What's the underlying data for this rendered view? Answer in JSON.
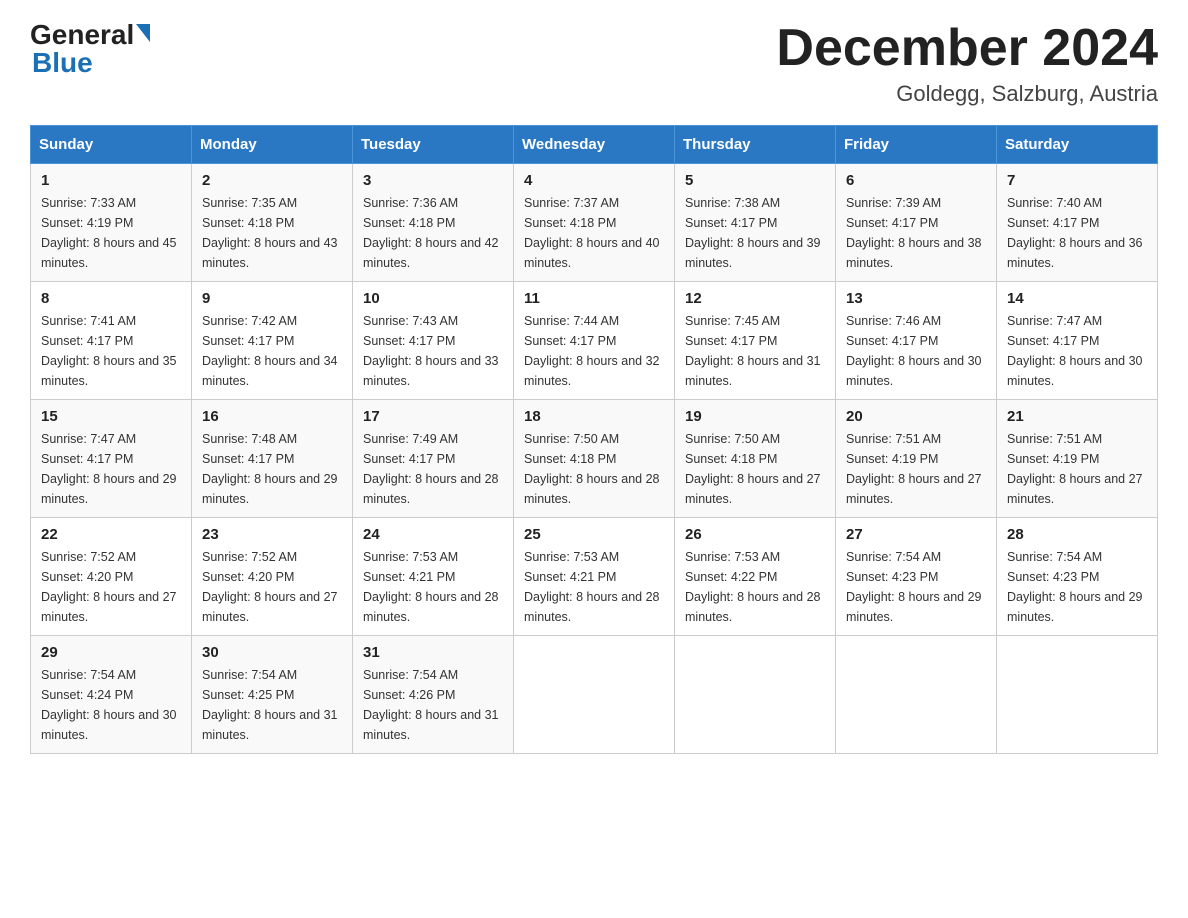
{
  "header": {
    "logo_general": "General",
    "logo_blue": "Blue",
    "month_title": "December 2024",
    "location": "Goldegg, Salzburg, Austria"
  },
  "days_of_week": [
    "Sunday",
    "Monday",
    "Tuesday",
    "Wednesday",
    "Thursday",
    "Friday",
    "Saturday"
  ],
  "weeks": [
    [
      {
        "day": "1",
        "sunrise": "7:33 AM",
        "sunset": "4:19 PM",
        "daylight": "8 hours and 45 minutes."
      },
      {
        "day": "2",
        "sunrise": "7:35 AM",
        "sunset": "4:18 PM",
        "daylight": "8 hours and 43 minutes."
      },
      {
        "day": "3",
        "sunrise": "7:36 AM",
        "sunset": "4:18 PM",
        "daylight": "8 hours and 42 minutes."
      },
      {
        "day": "4",
        "sunrise": "7:37 AM",
        "sunset": "4:18 PM",
        "daylight": "8 hours and 40 minutes."
      },
      {
        "day": "5",
        "sunrise": "7:38 AM",
        "sunset": "4:17 PM",
        "daylight": "8 hours and 39 minutes."
      },
      {
        "day": "6",
        "sunrise": "7:39 AM",
        "sunset": "4:17 PM",
        "daylight": "8 hours and 38 minutes."
      },
      {
        "day": "7",
        "sunrise": "7:40 AM",
        "sunset": "4:17 PM",
        "daylight": "8 hours and 36 minutes."
      }
    ],
    [
      {
        "day": "8",
        "sunrise": "7:41 AM",
        "sunset": "4:17 PM",
        "daylight": "8 hours and 35 minutes."
      },
      {
        "day": "9",
        "sunrise": "7:42 AM",
        "sunset": "4:17 PM",
        "daylight": "8 hours and 34 minutes."
      },
      {
        "day": "10",
        "sunrise": "7:43 AM",
        "sunset": "4:17 PM",
        "daylight": "8 hours and 33 minutes."
      },
      {
        "day": "11",
        "sunrise": "7:44 AM",
        "sunset": "4:17 PM",
        "daylight": "8 hours and 32 minutes."
      },
      {
        "day": "12",
        "sunrise": "7:45 AM",
        "sunset": "4:17 PM",
        "daylight": "8 hours and 31 minutes."
      },
      {
        "day": "13",
        "sunrise": "7:46 AM",
        "sunset": "4:17 PM",
        "daylight": "8 hours and 30 minutes."
      },
      {
        "day": "14",
        "sunrise": "7:47 AM",
        "sunset": "4:17 PM",
        "daylight": "8 hours and 30 minutes."
      }
    ],
    [
      {
        "day": "15",
        "sunrise": "7:47 AM",
        "sunset": "4:17 PM",
        "daylight": "8 hours and 29 minutes."
      },
      {
        "day": "16",
        "sunrise": "7:48 AM",
        "sunset": "4:17 PM",
        "daylight": "8 hours and 29 minutes."
      },
      {
        "day": "17",
        "sunrise": "7:49 AM",
        "sunset": "4:17 PM",
        "daylight": "8 hours and 28 minutes."
      },
      {
        "day": "18",
        "sunrise": "7:50 AM",
        "sunset": "4:18 PM",
        "daylight": "8 hours and 28 minutes."
      },
      {
        "day": "19",
        "sunrise": "7:50 AM",
        "sunset": "4:18 PM",
        "daylight": "8 hours and 27 minutes."
      },
      {
        "day": "20",
        "sunrise": "7:51 AM",
        "sunset": "4:19 PM",
        "daylight": "8 hours and 27 minutes."
      },
      {
        "day": "21",
        "sunrise": "7:51 AM",
        "sunset": "4:19 PM",
        "daylight": "8 hours and 27 minutes."
      }
    ],
    [
      {
        "day": "22",
        "sunrise": "7:52 AM",
        "sunset": "4:20 PM",
        "daylight": "8 hours and 27 minutes."
      },
      {
        "day": "23",
        "sunrise": "7:52 AM",
        "sunset": "4:20 PM",
        "daylight": "8 hours and 27 minutes."
      },
      {
        "day": "24",
        "sunrise": "7:53 AM",
        "sunset": "4:21 PM",
        "daylight": "8 hours and 28 minutes."
      },
      {
        "day": "25",
        "sunrise": "7:53 AM",
        "sunset": "4:21 PM",
        "daylight": "8 hours and 28 minutes."
      },
      {
        "day": "26",
        "sunrise": "7:53 AM",
        "sunset": "4:22 PM",
        "daylight": "8 hours and 28 minutes."
      },
      {
        "day": "27",
        "sunrise": "7:54 AM",
        "sunset": "4:23 PM",
        "daylight": "8 hours and 29 minutes."
      },
      {
        "day": "28",
        "sunrise": "7:54 AM",
        "sunset": "4:23 PM",
        "daylight": "8 hours and 29 minutes."
      }
    ],
    [
      {
        "day": "29",
        "sunrise": "7:54 AM",
        "sunset": "4:24 PM",
        "daylight": "8 hours and 30 minutes."
      },
      {
        "day": "30",
        "sunrise": "7:54 AM",
        "sunset": "4:25 PM",
        "daylight": "8 hours and 31 minutes."
      },
      {
        "day": "31",
        "sunrise": "7:54 AM",
        "sunset": "4:26 PM",
        "daylight": "8 hours and 31 minutes."
      },
      null,
      null,
      null,
      null
    ]
  ],
  "labels": {
    "sunrise_prefix": "Sunrise: ",
    "sunset_prefix": "Sunset: ",
    "daylight_prefix": "Daylight: "
  }
}
